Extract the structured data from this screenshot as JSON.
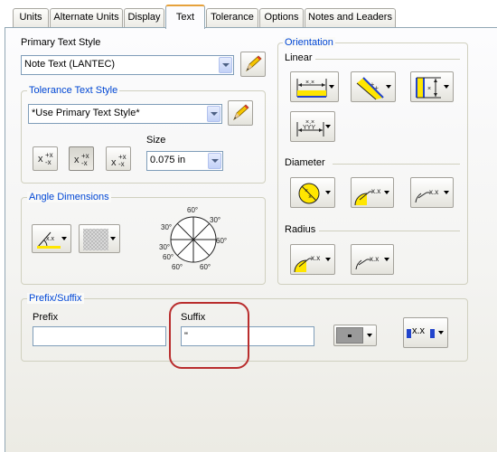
{
  "tabs": [
    {
      "label": "Units"
    },
    {
      "label": "Alternate Units"
    },
    {
      "label": "Display"
    },
    {
      "label": "Text"
    },
    {
      "label": "Tolerance"
    },
    {
      "label": "Options"
    },
    {
      "label": "Notes and Leaders"
    }
  ],
  "active_tab": "Text",
  "primary_text_style": {
    "label": "Primary Text Style",
    "value": "Note Text (LANTEC)"
  },
  "tolerance_text_style": {
    "title": "Tolerance Text Style",
    "value": "*Use Primary Text Style*",
    "size_label": "Size",
    "size_value": "0.075 in"
  },
  "angle_dimensions": {
    "title": "Angle Dimensions",
    "dial_labels": [
      "60°",
      "30°",
      "30°",
      "60°",
      "30°",
      "60°",
      "60°",
      "60°"
    ]
  },
  "orientation": {
    "title": "Orientation",
    "linear_label": "Linear",
    "diameter_label": "Diameter",
    "radius_label": "Radius",
    "glyph_xx": "x.x",
    "glyph_xxx": "×.×"
  },
  "prefix_suffix": {
    "title": "Prefix/Suffix",
    "prefix_label": "Prefix",
    "prefix_value": "",
    "suffix_label": "Suffix",
    "suffix_value": "\"",
    "xx_label": "x.x"
  },
  "colors": {
    "group_title": "#0046d5",
    "active_tab_accent": "#e6a23c",
    "annotation_circle": "#b92d2d",
    "icon_yellow": "#ffe600",
    "icon_blue": "#2244cc"
  },
  "icons": [
    "pencil-icon",
    "stacked-tolerance-icon",
    "diameter-icon",
    "radius-icon",
    "angle-dial-icon"
  ]
}
